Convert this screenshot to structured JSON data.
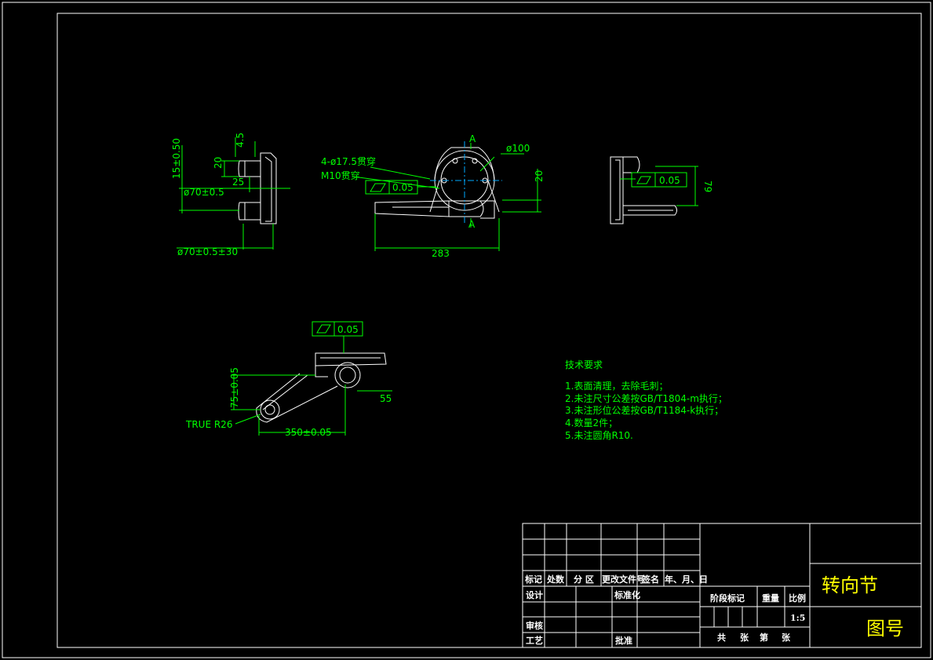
{
  "views": {
    "left_view": {
      "dim_15": "15±0.50",
      "dim_20": "20",
      "dim_25": "25",
      "dim_phi70": "ø70±0.5",
      "dim_phi70_30": "ø70±0.5±30",
      "dim_top": "4.5"
    },
    "front_view": {
      "hole_note_1": "4-ø17.5贯穿",
      "hole_note_2": "M10贯穿",
      "tol_value": "0.05",
      "dim_phi100": "ø100",
      "dim_20": "20",
      "dim_283": "283",
      "section_a": "A"
    },
    "right_view": {
      "tol_value": "0.05",
      "dim_79": "79"
    },
    "bottom_view": {
      "tol_value": "0.05",
      "dim_75": "75±0.05",
      "dim_55": "55",
      "dim_350": "350±0.05",
      "true_radius": "TRUE R26"
    }
  },
  "tech_requirements": {
    "title": "技术要求",
    "items": [
      "1.表面清理，去除毛刺；",
      "2.未注尺寸公差按GB/T1804-m执行；",
      "3.未注形位公差按GB/T1184-k执行；",
      "4.数量2件；",
      "5.未注圆角R10."
    ]
  },
  "title_block": {
    "part_name": "转向节",
    "drawing_no_label": "图号",
    "headers": [
      "标记",
      "处数",
      "分 区",
      "更改文件号",
      "签名",
      "年、月、日"
    ],
    "row_design": "设计",
    "row_standard": "标准化",
    "row_review": "审核",
    "row_process": "工艺",
    "row_approve": "批准",
    "stage_mark": "阶段标记",
    "weight": "重量",
    "scale_label": "比例",
    "scale_value": "1:5",
    "sheet_total": "共",
    "sheet_unit_1": "张",
    "sheet_no": "第",
    "sheet_unit_2": "张"
  },
  "colors": {
    "background": "#000000",
    "outline": "#ffffff",
    "dimension": "#00ff00",
    "centerline": "#00aaff",
    "title_text": "#ffff00"
  }
}
